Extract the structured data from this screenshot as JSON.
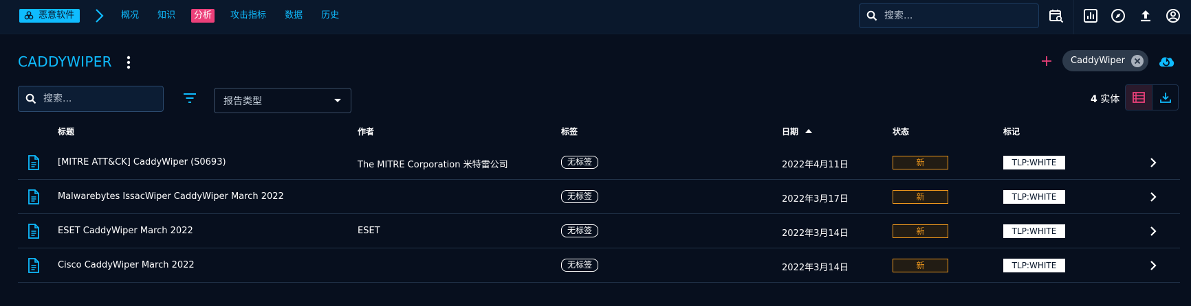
{
  "topbar": {
    "entity_chip": "恶意软件",
    "nav": [
      {
        "label": "概况",
        "active": false
      },
      {
        "label": "知识",
        "active": false
      },
      {
        "label": "分析",
        "active": true
      },
      {
        "label": "攻击指标",
        "active": false
      },
      {
        "label": "数据",
        "active": false
      },
      {
        "label": "历史",
        "active": false
      }
    ],
    "search_placeholder": "搜索...",
    "icons": [
      "search-icon",
      "calendar-search-icon",
      "chart-icon",
      "compass-icon",
      "upload-icon",
      "account-icon"
    ]
  },
  "header": {
    "title": "CADDYWIPER",
    "label_chip": "CaddyWiper"
  },
  "toolbar": {
    "search_placeholder": "搜索...",
    "report_type_label": "报告类型",
    "count_number": "4",
    "count_unit": "实体"
  },
  "table": {
    "headers": {
      "title": "标题",
      "author": "作者",
      "labels": "标签",
      "date": "日期",
      "status": "状态",
      "marking": "标记"
    },
    "rows": [
      {
        "title": "[MITRE ATT&CK] CaddyWiper (S0693)",
        "author": "The MITRE Corporation 米特雷公司",
        "label": "无标签",
        "date": "2022年4月11日",
        "status": "新",
        "marking": "TLP:WHITE"
      },
      {
        "title": "Malwarebytes IssacWiper CaddyWiper March 2022",
        "author": "",
        "label": "无标签",
        "date": "2022年3月17日",
        "status": "新",
        "marking": "TLP:WHITE"
      },
      {
        "title": "ESET CaddyWiper March 2022",
        "author": "ESET",
        "label": "无标签",
        "date": "2022年3月14日",
        "status": "新",
        "marking": "TLP:WHITE"
      },
      {
        "title": "Cisco CaddyWiper March 2022",
        "author": "",
        "label": "无标签",
        "date": "2022年3月14日",
        "status": "新",
        "marking": "TLP:WHITE"
      }
    ]
  },
  "colors": {
    "background": "#070f1e",
    "topbar": "#0a182c",
    "accent": "#0fbcff",
    "active_tab": "#ec407a",
    "status_new": "#f29a1d"
  }
}
